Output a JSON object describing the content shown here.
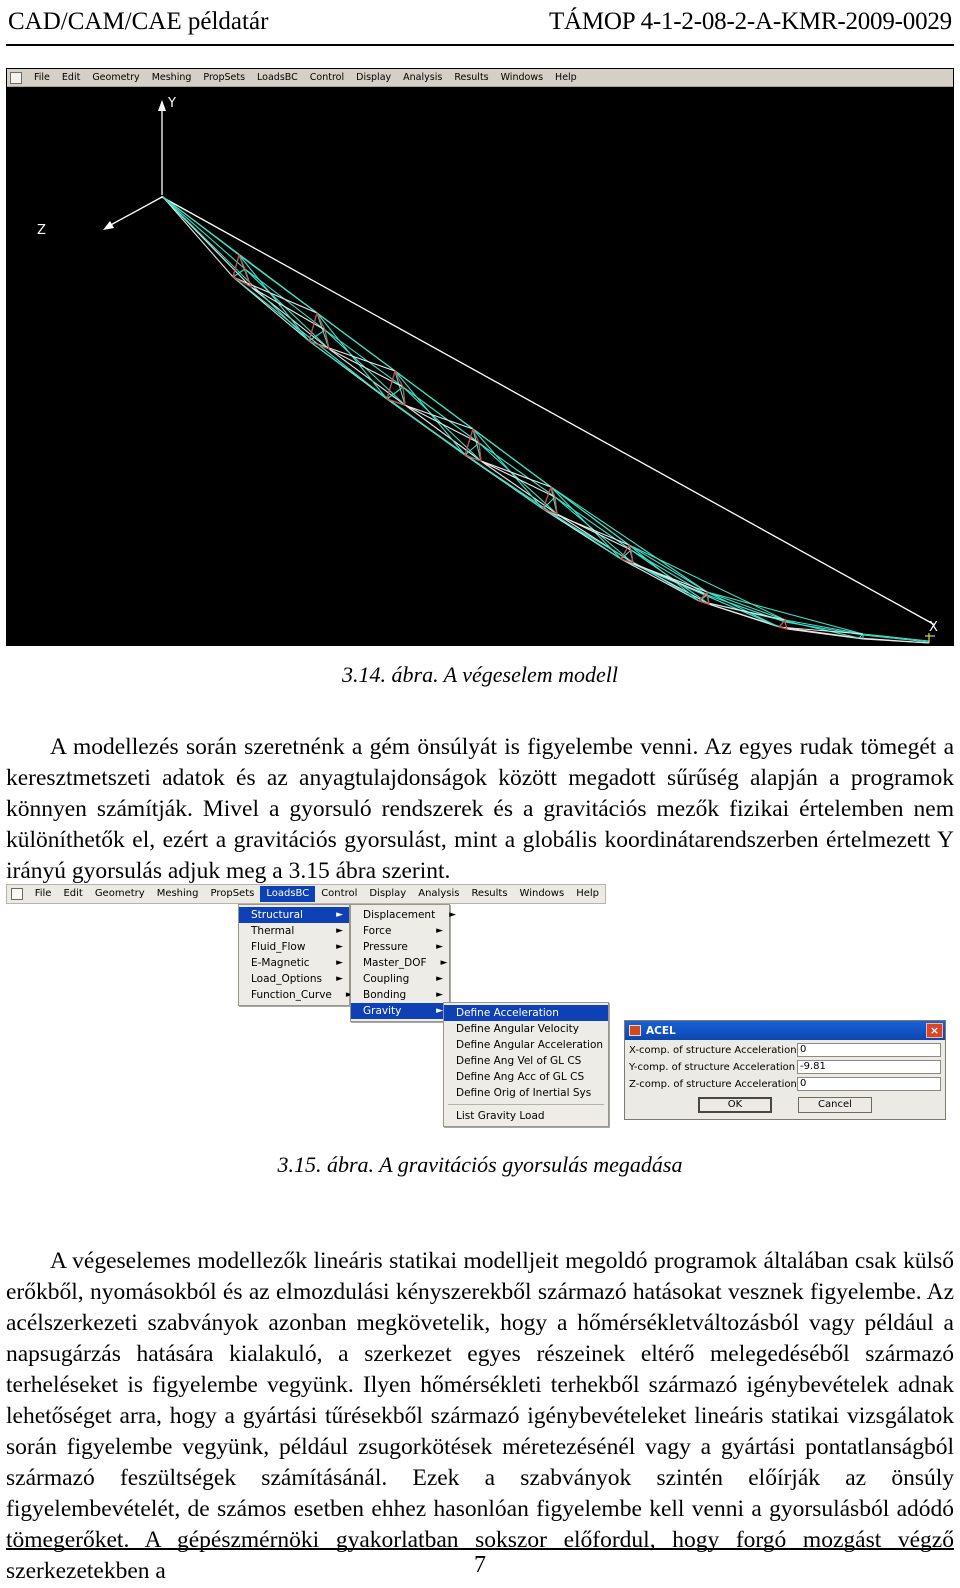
{
  "header": {
    "left": "CAD/CAM/CAE példatár",
    "right": "TÁMOP 4-1-2-08-2-A-KMR-2009-0029"
  },
  "figure1": {
    "menubar": [
      "File",
      "Edit",
      "Geometry",
      "Meshing",
      "PropSets",
      "LoadsBC",
      "Control",
      "Display",
      "Analysis",
      "Results",
      "Windows",
      "Help"
    ],
    "axes": {
      "y": "Y",
      "z": "Z",
      "x": "X"
    },
    "caption": "3.14. ábra. A végeselem modell",
    "colors": {
      "background": "#000000",
      "element_cyan": "#3fe0c8",
      "element_white": "#e8e8e8",
      "element_red": "#d04a4a",
      "axis": "#ffffff"
    }
  },
  "paragraph1": "A modellezés során szeretnénk a gém önsúlyát is figyelembe venni. Az egyes rudak tömegét a keresztmetszeti adatok és az anyagtulajdonságok között megadott sűrűség alapján a programok könnyen számítják. Mivel a gyorsuló rendszerek és a gravitációs mezők fizikai értelemben nem különíthetők el, ezért a gravitációs gyorsulást, mint a globális koordinátarendszerben értelmezett Y irányú gyorsulás adjuk meg a 3.15 ábra szerint.",
  "figure2": {
    "menubar": [
      "File",
      "Edit",
      "Geometry",
      "Meshing",
      "PropSets",
      "LoadsBC",
      "Control",
      "Display",
      "Analysis",
      "Results",
      "Windows",
      "Help"
    ],
    "menubar_selected": "LoadsBC",
    "menu_loadsbc": {
      "items": [
        {
          "label": "Structural",
          "submenu": true,
          "selected": true
        },
        {
          "label": "Thermal",
          "submenu": true,
          "selected": false
        },
        {
          "label": "Fluid_Flow",
          "submenu": true,
          "selected": false
        },
        {
          "label": "E-Magnetic",
          "submenu": true,
          "selected": false
        },
        {
          "label": "Load_Options",
          "submenu": true,
          "selected": false
        },
        {
          "label": "Function_Curve",
          "submenu": true,
          "selected": false
        }
      ]
    },
    "menu_structural": {
      "items": [
        {
          "label": "Displacement",
          "submenu": true,
          "selected": false
        },
        {
          "label": "Force",
          "submenu": true,
          "selected": false
        },
        {
          "label": "Pressure",
          "submenu": true,
          "selected": false
        },
        {
          "label": "Master_DOF",
          "submenu": true,
          "selected": false
        },
        {
          "label": "Coupling",
          "submenu": true,
          "selected": false
        },
        {
          "label": "Bonding",
          "submenu": true,
          "selected": false
        },
        {
          "label": "Gravity",
          "submenu": true,
          "selected": true
        }
      ]
    },
    "menu_gravity": {
      "items": [
        {
          "label": "Define Acceleration",
          "selected": true
        },
        {
          "label": "Define Angular Velocity",
          "selected": false
        },
        {
          "label": "Define Angular Acceleration",
          "selected": false
        },
        {
          "label": "Define Ang Vel of GL CS",
          "selected": false
        },
        {
          "label": "Define Ang Acc of GL CS",
          "selected": false
        },
        {
          "label": "Define Orig of Inertial Sys",
          "selected": false
        }
      ],
      "after_separator": [
        {
          "label": "List Gravity Load",
          "selected": false
        }
      ]
    },
    "dialog": {
      "title": "ACEL",
      "close_label": "×",
      "fields": [
        {
          "label": "X-comp. of structure Acceleration",
          "value": "0"
        },
        {
          "label": "Y-comp. of structure Acceleration",
          "value": "-9.81"
        },
        {
          "label": "Z-comp. of structure Acceleration",
          "value": "0"
        }
      ],
      "ok_label": "OK",
      "cancel_label": "Cancel"
    },
    "caption": "3.15. ábra. A gravitációs gyorsulás megadása"
  },
  "paragraph2": "A végeselemes modellezők lineáris statikai modelljeit megoldó programok általában csak külső erőkből, nyomásokból és az elmozdulási kényszerekből származó hatásokat vesznek figyelembe. Az acélszerkezeti szabványok azonban megkövetelik, hogy a hőmérsékletváltozásból vagy például a napsugárzás hatására kialakuló, a szerkezet egyes részeinek eltérő melegedéséből származó terheléseket is figyelembe vegyünk. Ilyen hőmérsékleti terhekből származó igénybevételek adnak lehetőséget arra, hogy a gyártási tűrésekből származó igénybevételeket lineáris statikai vizsgálatok során figyelembe vegyünk, például zsugorkötések méretezésénél vagy a gyártási pontatlanságból származó feszültségek számításánál. Ezek a szabványok szintén előírják az önsúly figyelembevételét, de számos esetben ehhez hasonlóan figyelembe kell venni a gyorsulásból adódó tömegerőket. A gépészmérnöki gyakorlatban sokszor előfordul, hogy forgó mozgást végző szerkezetekben a",
  "footer": {
    "page_number": "7"
  }
}
